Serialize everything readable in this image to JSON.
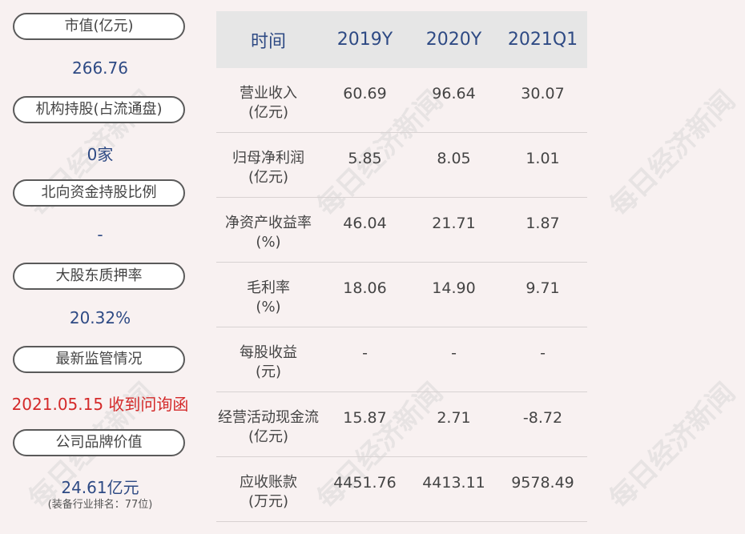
{
  "left_panel": {
    "items": [
      {
        "label": "市值(亿元)",
        "value": "266.76"
      },
      {
        "label": "机构持股(占流通盘)",
        "value": "0家"
      },
      {
        "label": "北向资金持股比例",
        "value": "-"
      },
      {
        "label": "大股东质押率",
        "value": "20.32%"
      },
      {
        "label": "最新监管情况",
        "value": "2021.05.15 收到问询函"
      },
      {
        "label": "公司品牌价值",
        "value": "24.61亿元",
        "note": "(装备行业排名：77位)"
      }
    ]
  },
  "table": {
    "headers": [
      "时间",
      "2019Y",
      "2020Y",
      "2021Q1"
    ],
    "rows": [
      {
        "label1": "营业收入",
        "label2": "(亿元)",
        "values": [
          "60.69",
          "96.64",
          "30.07"
        ]
      },
      {
        "label1": "归母净利润",
        "label2": "(亿元)",
        "values": [
          "5.85",
          "8.05",
          "1.01"
        ]
      },
      {
        "label1": "净资产收益率",
        "label2": "(%)",
        "values": [
          "46.04",
          "21.71",
          "1.87"
        ]
      },
      {
        "label1": "毛利率",
        "label2": "(%)",
        "values": [
          "18.06",
          "14.90",
          "9.71"
        ]
      },
      {
        "label1": "每股收益",
        "label2": "(元)",
        "values": [
          "-",
          "-",
          "-"
        ]
      },
      {
        "label1": "经营活动现金流",
        "label2": "(亿元)",
        "values": [
          "15.87",
          "2.71",
          "-8.72"
        ]
      },
      {
        "label1": "应收账款",
        "label2": "(万元)",
        "values": [
          "4451.76",
          "4413.11",
          "9578.49"
        ]
      }
    ]
  },
  "watermark": "每日经济新闻"
}
